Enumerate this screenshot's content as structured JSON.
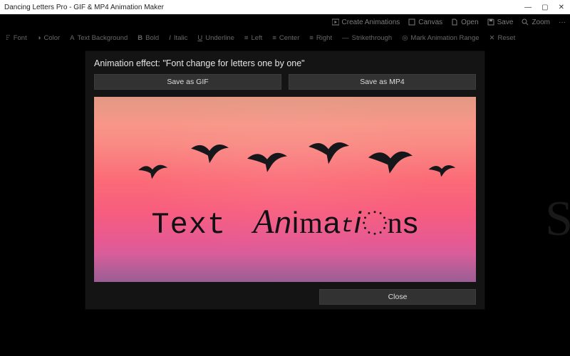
{
  "window": {
    "title": "Dancing Letters Pro - GIF & MP4 Animation Maker"
  },
  "menubar": {
    "create": "Create Animations",
    "canvas": "Canvas",
    "open": "Open",
    "save": "Save",
    "zoom": "Zoom"
  },
  "toolbar": {
    "font": "Font",
    "color": "Color",
    "text_bg": "Text Background",
    "bold": "Bold",
    "italic": "Italic",
    "underline": "Underline",
    "left": "Left",
    "center": "Center",
    "right": "Right",
    "strike": "Strikethrough",
    "mark_range": "Mark Animation Range",
    "reset": "Reset"
  },
  "dialog": {
    "title": "Animation effect: \"Font change for letters one by one\"",
    "save_gif": "Save as GIF",
    "save_mp4": "Save as MP4",
    "close": "Close"
  },
  "preview": {
    "word1": "Text",
    "word2_letters": [
      "A",
      "n",
      "i",
      "m",
      "a",
      "t",
      "i",
      "o",
      "n",
      "s"
    ],
    "background_glyph": "S"
  }
}
